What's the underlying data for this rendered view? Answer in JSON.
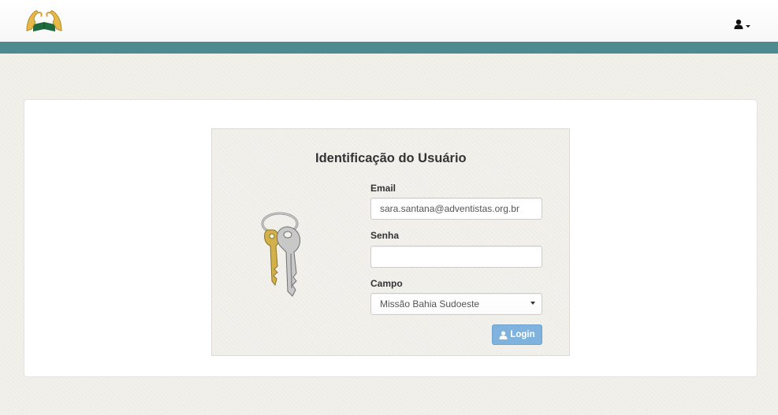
{
  "header": {
    "logo_icon": "hands-book-logo-icon",
    "user_menu_icon": "user-icon"
  },
  "colors": {
    "accent_bar": "#4e8b91",
    "login_button": "#7fb2dc"
  },
  "login": {
    "title": "Identificação do Usuário",
    "illustration_icon": "keys-icon",
    "email_label": "Email",
    "email_value": "sara.santana@adventistas.org.br",
    "password_label": "Senha",
    "password_value": "",
    "campo_label": "Campo",
    "campo_selected": "Missão Bahia Sudoeste",
    "login_button": "Login"
  }
}
